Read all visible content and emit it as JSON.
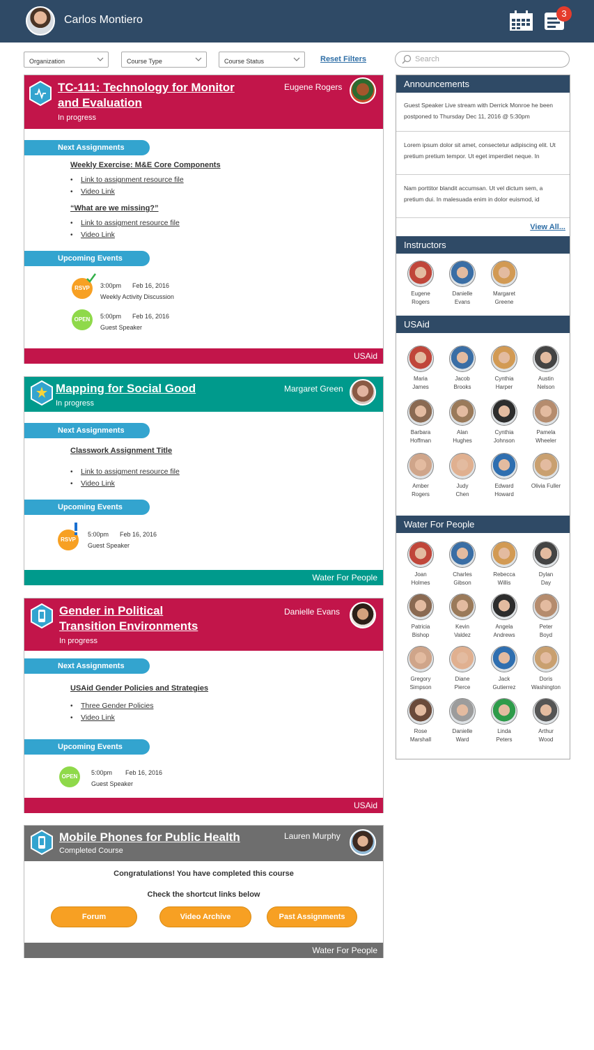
{
  "header": {
    "user_name": "Carlos Montiero",
    "notification_count": "3"
  },
  "filters": {
    "organization": "Organization",
    "course_type": "Course Type",
    "course_status": "Course Status",
    "reset": "Reset Filters",
    "search_placeholder": "Search"
  },
  "courses": [
    {
      "title_line1": "TC-111: Technology for Monitor",
      "title_line2": "and Evaluation",
      "status": "In progress",
      "instructor": "Eugene Rogers",
      "next_label": "Next Assignments",
      "assignments": [
        {
          "title": "Weekly Exercise: M&E Core Components",
          "links": [
            "Link to assignment resource file",
            "Video Link"
          ]
        },
        {
          "title": "“What are we missing?”",
          "links": [
            "Link to assigment resource file",
            "Video Link"
          ]
        }
      ],
      "events_label": "Upcoming Events",
      "events": [
        {
          "badge": "RSVP",
          "time": "3:00pm",
          "date": "Feb 16, 2016",
          "name": "Weekly Activity Discussion"
        },
        {
          "badge": "OPEN",
          "time": "5:00pm",
          "date": "Feb 16, 2016",
          "name": "Guest Speaker"
        }
      ],
      "org": "USAid",
      "color": "#c2154a"
    },
    {
      "title_line1": "Mapping for Social Good",
      "status": "In progress",
      "instructor": "Margaret Green",
      "next_label": "Next Assignments",
      "assignments": [
        {
          "title": "Classwork Assignment Title",
          "links": [
            "Link to assigment resource file",
            "Video Link"
          ]
        }
      ],
      "events_label": "Upcoming Events",
      "events": [
        {
          "badge": "RSVP",
          "time": "5:00pm",
          "date": "Feb 16, 2016",
          "name": "Guest Speaker"
        }
      ],
      "org": "Water For People",
      "color": "#009a8c"
    },
    {
      "title_line1": "Gender in Political",
      "title_line2": "Transition Environments",
      "status": "In progress",
      "instructor": "Danielle Evans",
      "next_label": "Next Assignments",
      "assignments": [
        {
          "title": "USAid Gender Policies and Strategies",
          "links": [
            "Three Gender Policies",
            "Video Link"
          ]
        }
      ],
      "events_label": "Upcoming Events",
      "events": [
        {
          "badge": "OPEN",
          "time": "5:00pm",
          "date": "Feb 16, 2016",
          "name": "Guest Speaker"
        }
      ],
      "org": "USAid",
      "color": "#c2154a"
    },
    {
      "title_line1": "Mobile Phones for Public Health",
      "status": "Completed Course",
      "instructor": "Lauren Murphy",
      "congrats": "Congratulations! You have completed this course",
      "shortcut": "Check the shortcut links below",
      "buttons": [
        "Forum",
        "Video Archive",
        "Past Assignments"
      ],
      "org": "Water For People",
      "color": "#6e6e6e"
    }
  ],
  "sidebar": {
    "announcements_title": "Announcements",
    "announcements": [
      "Guest Speaker Live stream with Derrick Monroe he been postponed to Thursday Dec 11, 2016 @ 5:30pm",
      "Lorem ipsum dolor sit amet, consectetur adipiscing elit. Ut pretium pretium tempor. Ut eget imperdiet neque. In",
      "Nam porttitor blandit accumsan. Ut vel dictum sem, a pretium dui. In malesuada enim in dolor euismod, id"
    ],
    "view_all": "View All...",
    "instructors_title": "Instructors",
    "instructors": [
      [
        "Eugene",
        "Rogers"
      ],
      [
        "Danielle",
        "Evans"
      ],
      [
        "Margaret",
        "Greene"
      ]
    ],
    "usaid_title": "USAid",
    "usaid_members": [
      [
        "Maria",
        "James"
      ],
      [
        "Jacob",
        "Brooks"
      ],
      [
        "Cynthia",
        "Harper"
      ],
      [
        "Austin",
        "Nelson"
      ],
      [
        "Barbara",
        "Hoffman"
      ],
      [
        "Alan",
        "Hughes"
      ],
      [
        "Cynthia",
        "Johnson"
      ],
      [
        "Pamela",
        "Wheeler"
      ],
      [
        "Amber",
        "Rogers"
      ],
      [
        "Judy",
        "Chen"
      ],
      [
        "Edward",
        "Howard"
      ],
      [
        "Olivia Fuller",
        ""
      ]
    ],
    "wfp_title": "Water For People",
    "wfp_members": [
      [
        "Joan",
        "Holmes"
      ],
      [
        "Charles",
        "Gibson"
      ],
      [
        "Rebecca",
        "Willis"
      ],
      [
        "Dylan",
        "Day"
      ],
      [
        "Patricia",
        "Bishop"
      ],
      [
        "Kevin",
        "Valdez"
      ],
      [
        "Angela",
        "Andrews"
      ],
      [
        "Peter",
        "Boyd"
      ],
      [
        "Gregory",
        "Simpson"
      ],
      [
        "Diane",
        "Pierce"
      ],
      [
        "Jack",
        "Gutierrez"
      ],
      [
        "Doris",
        "Washington"
      ],
      [
        "Rose",
        "Marshall"
      ],
      [
        "Danielle",
        "Ward"
      ],
      [
        "Linda",
        "Peters"
      ],
      [
        "Arthur",
        "Wood"
      ]
    ]
  },
  "colors": {
    "navy": "#2f4a66",
    "crimson": "#c2154a",
    "teal": "#009a8c",
    "gray": "#6e6e6e",
    "pill": "#33a4cf",
    "rsvp": "#f7a023",
    "open": "#8fd94a"
  }
}
